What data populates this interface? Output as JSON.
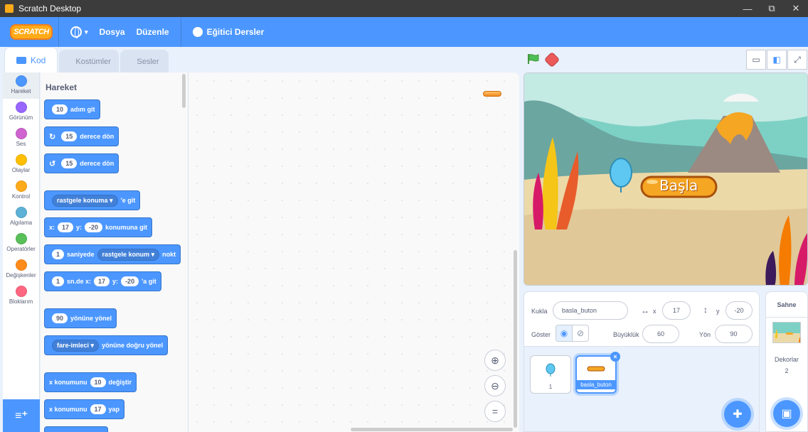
{
  "window": {
    "title": "Scratch Desktop",
    "min": "—",
    "restore": "⧉",
    "close": "✕"
  },
  "menubar": {
    "logo": "SCRATCH",
    "language_caret": "▾",
    "file": "Dosya",
    "edit": "Düzenle",
    "tutorials": "Eğitici Dersler"
  },
  "tabs": [
    {
      "label": "Kod"
    },
    {
      "label": "Kostümler"
    },
    {
      "label": "Sesler"
    }
  ],
  "categories": [
    {
      "label": "Hareket",
      "color": "#4c97ff"
    },
    {
      "label": "Görünüm",
      "color": "#9966ff"
    },
    {
      "label": "Ses",
      "color": "#cf63cf"
    },
    {
      "label": "Olaylar",
      "color": "#ffbf00"
    },
    {
      "label": "Kontrol",
      "color": "#ffab19"
    },
    {
      "label": "Algılama",
      "color": "#5cb1d6"
    },
    {
      "label": "Operatörler",
      "color": "#59c059"
    },
    {
      "label": "Değişkenler",
      "color": "#ff8c1a"
    },
    {
      "label": "Bloklarım",
      "color": "#ff6680"
    }
  ],
  "palette": {
    "title": "Hareket",
    "move": {
      "steps": "10",
      "text": "adım git"
    },
    "turn_right": {
      "degrees": "15",
      "text": "derece dön"
    },
    "turn_left": {
      "degrees": "15",
      "text": "derece dön"
    },
    "goto_random": {
      "target": "rastgele konuma",
      "text": "'e git"
    },
    "goto_xy": {
      "x_label": "x:",
      "x": "17",
      "y_label": "y:",
      "y": "-20",
      "text": "konumuna git"
    },
    "glide_random": {
      "secs": "1",
      "text1": "saniyede",
      "target": "rastgele konum",
      "text2": "nokt"
    },
    "glide_xy": {
      "secs": "1",
      "text1": "sn.de x:",
      "x": "17",
      "y_label": "y:",
      "y": "-20",
      "text2": "'a git"
    },
    "point_dir": {
      "deg": "90",
      "text": "yönüne yönel"
    },
    "point_towards": {
      "target": "fare-imleci",
      "text": "yönüne doğru yönel"
    },
    "change_x": {
      "text1": "x konumunu",
      "val": "10",
      "text2": "değiştir"
    },
    "set_x": {
      "text1": "x konumunu",
      "val": "17",
      "text2": "yap"
    }
  },
  "zoom": {
    "in": "⊕",
    "out": "⊖",
    "reset": "="
  },
  "stage": {
    "button_text": "Başla"
  },
  "sprite_info": {
    "sprite_label": "Kukla",
    "sprite_name": "basla_buton",
    "x_label": "x",
    "x": "17",
    "y_label": "y",
    "y": "-20",
    "show_label": "Göster",
    "size_label": "Büyüklük",
    "size": "60",
    "direction_label": "Yön",
    "direction": "90"
  },
  "sprites": [
    {
      "name": "1"
    },
    {
      "name": "basla_buton"
    }
  ],
  "stage_target": {
    "header": "Sahne",
    "backdrops_label": "Dekorlar",
    "backdrops_count": "2"
  },
  "colors": {
    "accent": "#4c97ff",
    "motion": "#4c97ff",
    "looks": "#9966ff",
    "events": "#ffbf00",
    "control": "#ffab19"
  }
}
